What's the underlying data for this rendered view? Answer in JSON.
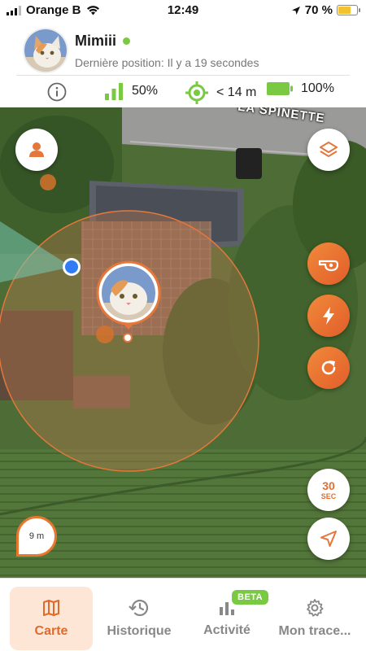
{
  "status_bar": {
    "carrier": "Orange B",
    "time": "12:49",
    "battery_percent": "70 %",
    "icons": [
      "cellular-signal-icon",
      "wifi-icon",
      "location-arrow-icon",
      "battery-icon"
    ]
  },
  "pet": {
    "name": "Mimiii",
    "status": "online",
    "last_position": "Dernière position: Il y a 19 secondes"
  },
  "stats": {
    "signal": "50%",
    "accuracy": "< 14 m",
    "battery": "100%"
  },
  "map": {
    "street_label": "LA SPINETTE",
    "scale": "9 m",
    "live_timer": {
      "value": "30",
      "unit": "SEC"
    },
    "buttons": {
      "left": [
        "person-icon"
      ],
      "right_top": [
        "layers-icon"
      ],
      "right_actions": [
        "whistle-icon",
        "bolt-icon",
        "refresh-icon"
      ],
      "bottom_right": [
        "navigation-arrow-icon"
      ]
    }
  },
  "bottom_nav": {
    "items": [
      {
        "label": "Carte",
        "icon": "map-icon",
        "active": true
      },
      {
        "label": "Historique",
        "icon": "history-icon",
        "active": false
      },
      {
        "label": "Activité",
        "icon": "activity-icon",
        "active": false,
        "badge": "BETA"
      },
      {
        "label": "Mon trace...",
        "icon": "gear-icon",
        "active": false
      }
    ]
  },
  "colors": {
    "accent": "#e56d2e",
    "green": "#7ac943",
    "active_tab_bg": "#fde6d5"
  }
}
